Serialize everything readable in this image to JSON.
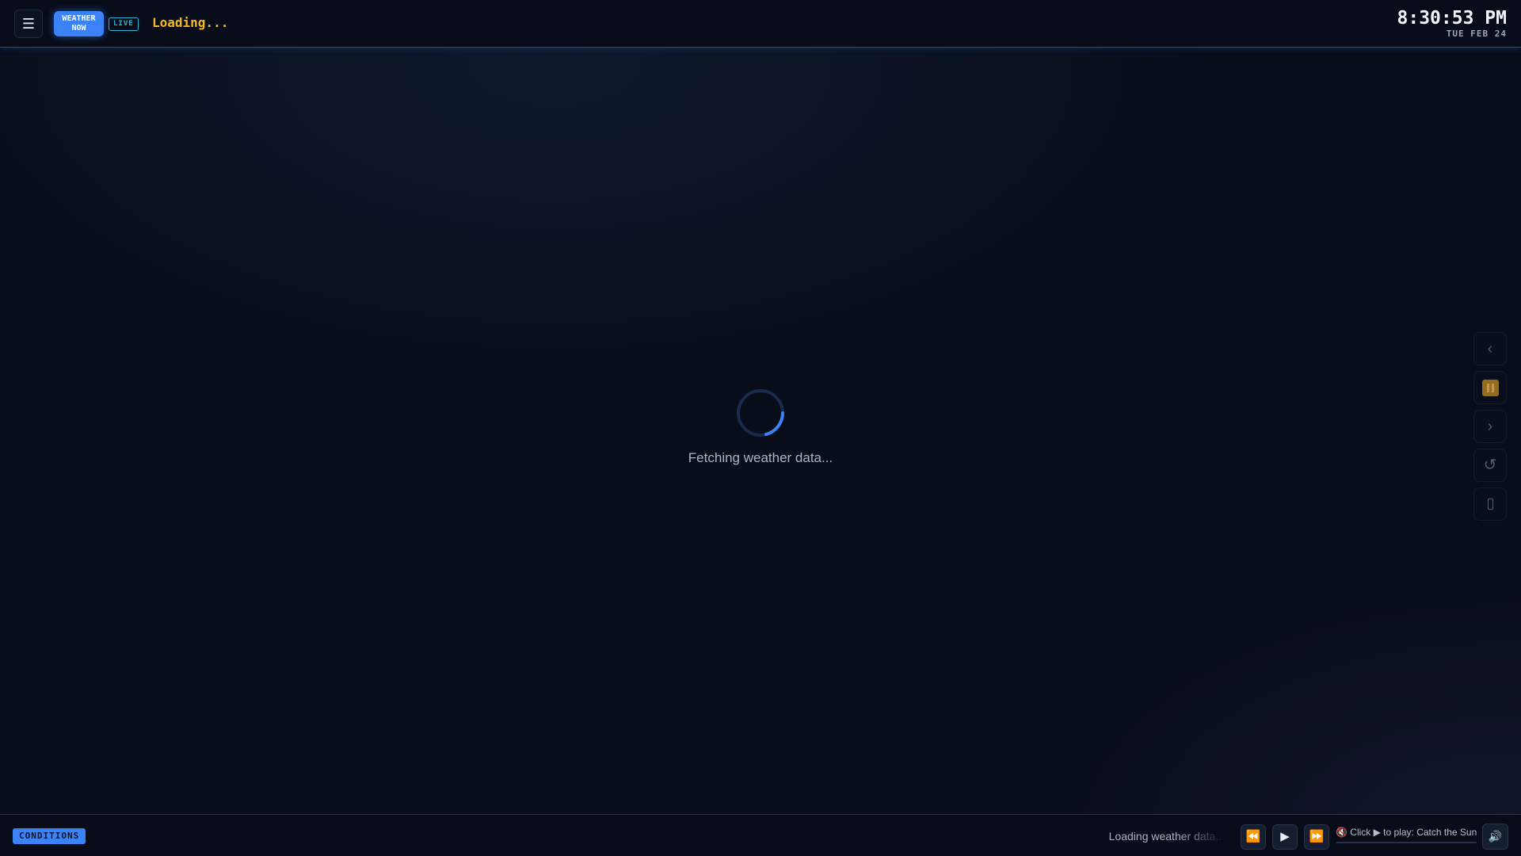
{
  "header": {
    "menu_icon_glyph": "☰",
    "brand": {
      "line1": "WEATHER",
      "line2": "NOW"
    },
    "live_label": "LIVE",
    "location_title": "Loading...",
    "clock": {
      "time": "8:30:53 PM",
      "date": "TUE FEB 24"
    }
  },
  "loader": {
    "message": "Fetching weather data..."
  },
  "side_controls": {
    "prev_glyph": "‹",
    "next_glyph": "›",
    "refresh_glyph": "↺"
  },
  "footer": {
    "section_label": "CONDITIONS",
    "ticker_text": "Loading weather data...",
    "media": {
      "rewind_glyph": "⏪",
      "play_glyph": "▶",
      "fast_forward_glyph": "⏩",
      "now_playing": "🔇 Click ▶ to play: Catch the Sun",
      "progress": 0,
      "volume_glyph": "🔊"
    }
  },
  "colors": {
    "accent": "#3b82f6",
    "live": "#22b8d6",
    "title": "#f5b823",
    "background": "#080d1a"
  },
  "icons": [
    "menu-icon",
    "chevron-left-icon",
    "pause-icon",
    "chevron-right-icon",
    "refresh-icon",
    "unknown-glyph-icon",
    "rewind-icon",
    "play-icon",
    "fast-forward-icon",
    "mute-icon",
    "volume-icon"
  ]
}
